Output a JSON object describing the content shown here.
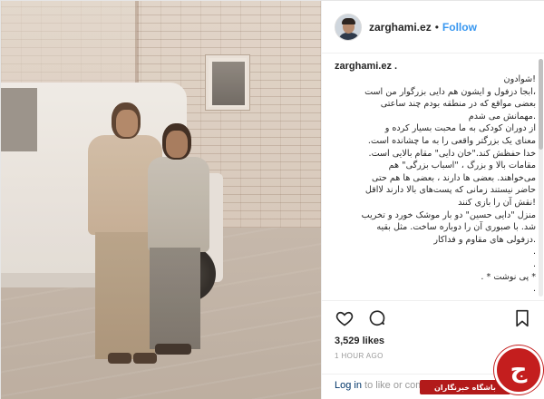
{
  "header": {
    "username": "zarghami.ez",
    "separator": "•",
    "follow_label": "Follow"
  },
  "caption": {
    "username": "zarghami.ez .",
    "text": "!شوادون\n،ابجا دزفول و ایشون هم دایی بزرگوار من است\nبعضی مواقع که در منطقه بودم چند ساعتی\n.مهمانش می شدم\nاز دوران کودکی به ما محبت بسیار کرده و\nمعنای یک بزرگتر واقعی را به ما چشانده است.\nخدا حفظش کند.\"خان دایی\" مقام بالایی است.\nمقامات بالا و بزرگ ، \"اسباب بزرگی\" هم\nمی‌خواهند. بعضی ها دارند ، بعضی ها هم حتی\nحاضر نیستند زمانی که پست‌های بالا دارند لااقل\n!نقش آن را بازی کنند\nمنزل \"دایی حسین\" دو بار موشک خورد و تخریب\nشد. با صبوری آن را دوباره ساخت. مثل بقیه\n.دزفولی های مقاوم و فداکار\n.\n.\n* پی نوشت * .\n."
  },
  "actions": {
    "like_icon": "heart-icon",
    "comment_icon": "comment-bubble-icon",
    "bookmark_icon": "bookmark-icon"
  },
  "likes": "3,529 likes",
  "timestamp": "1 HOUR AGO",
  "login": {
    "link": "Log in",
    "rest": " to like or comment."
  },
  "badge": {
    "text": "باشگاه خبرنگاران",
    "mark": "ج"
  },
  "colors": {
    "follow_blue": "#3897f0",
    "badge_red": "#c41e1e"
  }
}
